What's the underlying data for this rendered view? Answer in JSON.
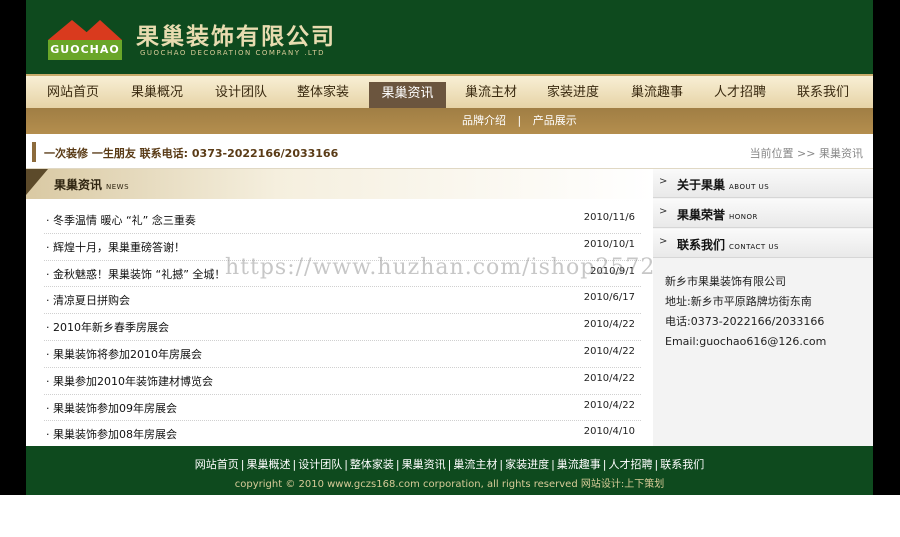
{
  "header": {
    "logo_text": "GUOCHAO",
    "company_cn": "果巢装饰有限公司",
    "company_en": "GUOCHAO DECORATION COMPANY .LTD"
  },
  "nav": {
    "items": [
      "网站首页",
      "果巢概况",
      "设计团队",
      "整体家装",
      "果巢资讯",
      "巢流主材",
      "家装进度",
      "巢流趣事",
      "人才招聘",
      "联系我们"
    ],
    "active": "果巢资讯"
  },
  "subnav": {
    "items": [
      "品牌介绍",
      "产品展示"
    ],
    "separator": "|"
  },
  "infobar": {
    "slogan": "一次装修  一生朋友  联系电话: 0373-2022166/2033166",
    "breadcrumb": "当前位置 >> 果巢资讯"
  },
  "news": {
    "title": "果巢资讯",
    "title_en": "NEWS",
    "items": [
      {
        "title": "· 冬季温情 暖心 “礼” 念三重奏",
        "date": "2010/11/6"
      },
      {
        "title": "· 辉煌十月，果巢重磅答谢！",
        "date": "2010/10/1"
      },
      {
        "title": "· 金秋魅惑！果巢装饰 “礼撼” 全城！",
        "date": "2010/9/1"
      },
      {
        "title": "· 清凉夏日拼购会",
        "date": "2010/6/17"
      },
      {
        "title": "· 2010年新乡春季房展会",
        "date": "2010/4/22"
      },
      {
        "title": "· 果巢装饰将参加2010年房展会",
        "date": "2010/4/22"
      },
      {
        "title": "· 果巢参加2010年装饰建材博览会",
        "date": "2010/4/22"
      },
      {
        "title": "· 果巢装饰参加09年房展会",
        "date": "2010/4/22"
      },
      {
        "title": "· 果巢装饰参加08年房展会",
        "date": "2010/4/10"
      }
    ]
  },
  "sidebar": {
    "arrow": ">",
    "items": [
      {
        "label": "关于果巢",
        "en": "ABOUT US"
      },
      {
        "label": "果巢荣誉",
        "en": "HONOR"
      },
      {
        "label": "联系我们",
        "en": "CONTACT US"
      }
    ],
    "contact": {
      "company": "新乡市果巢装饰有限公司",
      "address": "地址:新乡市平原路牌坊街东南",
      "phone": "电话:0373-2022166/2033166",
      "email": "Email:guochao616@126.com"
    }
  },
  "watermark": "https://www.huzhan.com/ishop2572",
  "footer": {
    "links": [
      "网站首页",
      "果巢概述",
      "设计团队",
      "整体家装",
      "果巢资讯",
      "巢流主材",
      "家装进度",
      "巢流趣事",
      "人才招聘",
      "联系我们"
    ],
    "separator": "|",
    "copyright": "copyright © 2010 www.gczs168.com corporation, all rights reserved 网站设计:上下策划"
  },
  "colors": {
    "header_green": "#0e4a1e",
    "nav_active": "#6b553e",
    "subnav_gold": "#a07e44"
  }
}
